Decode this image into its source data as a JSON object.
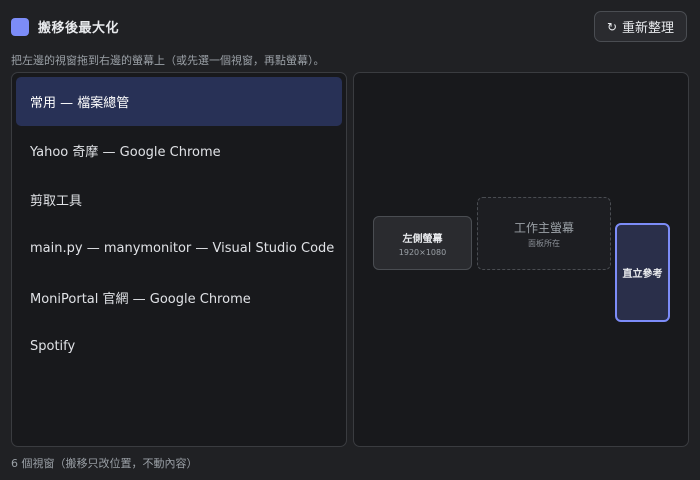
{
  "header": {
    "title": "搬移後最大化",
    "refresh_label": "重新整理",
    "refresh_icon": "refresh-icon"
  },
  "instructions": "把左邊的視窗拖到右邊的螢幕上（或先選一個視窗，再點螢幕）。",
  "window_list": {
    "items": [
      {
        "label": "常用 — 檔案總管",
        "selected": true
      },
      {
        "label": "Yahoo 奇摩 — Google Chrome",
        "selected": false
      },
      {
        "label": "剪取工具",
        "selected": false
      },
      {
        "label": "main.py — manymonitor — Visual Studio Code",
        "selected": false
      },
      {
        "label": "MoniPortal 官網 — Google Chrome",
        "selected": false
      },
      {
        "label": "Spotify",
        "selected": false
      }
    ]
  },
  "monitors": {
    "left": {
      "name": "左側螢幕",
      "resolution": "1920×1080"
    },
    "main": {
      "name": "工作主螢幕",
      "note": "面板所在"
    },
    "vertical": {
      "name": "直立參考"
    }
  },
  "footer": "6 個視窗（搬移只改位置，不動內容）",
  "colors": {
    "accent": "#7c8cf8",
    "background": "#202124",
    "selected_row": "#283156"
  }
}
